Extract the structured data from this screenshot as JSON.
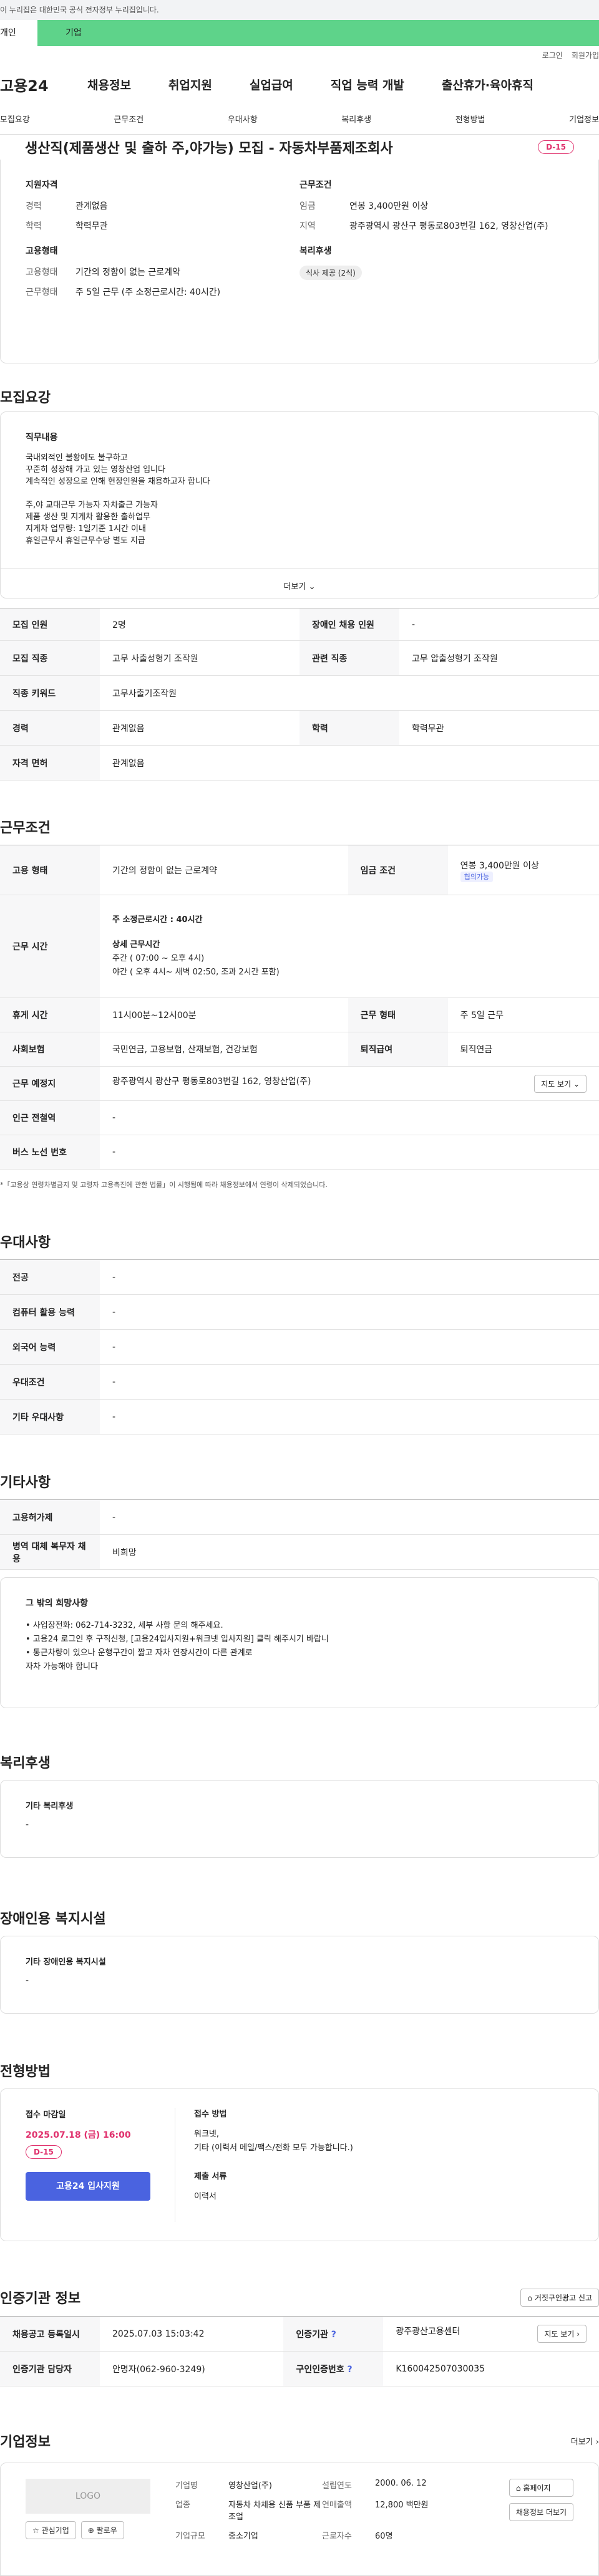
{
  "gov": {
    "notice": "이 누리집은 대한민국 공식 전자정부 누리집입니다."
  },
  "toptabs": [
    "개인",
    "기업"
  ],
  "util": [
    "로그인",
    "회원가입"
  ],
  "gnb": {
    "logo": "고용24",
    "menus": [
      "채용정보",
      "취업지원",
      "실업급여",
      "직업 능력 개발",
      "출산휴가·육아휴직"
    ]
  },
  "subnav": [
    "모집요강",
    "근무조건",
    "우대사항",
    "복리후생",
    "전형방법",
    "기업정보"
  ],
  "job": {
    "title": "생산직(제품생산 및 출하 주,야가능) 모집 - 자동차부품제조회사",
    "dday": "D-15"
  },
  "summary": {
    "q": {
      "title": "지원자격",
      "rows": [
        [
          "경력",
          "관계없음"
        ],
        [
          "학력",
          "학력무관"
        ]
      ]
    },
    "w": {
      "title": "근무조건",
      "rows": [
        [
          "임금",
          "연봉 3,400만원 이상"
        ],
        [
          "지역",
          "광주광역시 광산구 평동로803번길 162, 영창산업(주)"
        ]
      ]
    },
    "e": {
      "title": "고용형태",
      "rows": [
        [
          "고용형태",
          "기간의 정함이 없는 근로계약"
        ],
        [
          "근무형태",
          "주 5일 근무 (주 소정근로시간: 40시간)"
        ]
      ]
    },
    "b": {
      "title": "복리후생",
      "chip": "식사 제공 (2식)"
    }
  },
  "recruit": {
    "section": "모집요강",
    "dutyTitle": "직무내용",
    "lines": [
      "국내외적인 불황에도 불구하고",
      "꾸준히 성장해 가고 있는 영창산업 입니다",
      "계속적인 성장으로 인해 현장인원을 채용하고자 합니다",
      "",
      "주,야 교대근무 가능자 자차출근 가능자",
      "제품 생산 및 지게차 활용한 출하업무",
      "지게차 업무량: 1일기준 1시간 이내",
      "휴일근무시  휴일근무수당 별도 지급"
    ],
    "more": "더보기",
    "rows": [
      [
        "모집 인원",
        "2명",
        "장애인 채용 인원",
        "-"
      ],
      [
        "모집 직종",
        "고무 사출성형기 조작원",
        "관련 직종",
        "고무 압출성형기 조작원"
      ],
      [
        "직종 키워드",
        "고무사출기조작원",
        "",
        ""
      ],
      [
        "경력",
        "관계없음",
        "학력",
        "학력무관"
      ],
      [
        "자격 면허",
        "관계없음",
        "",
        ""
      ]
    ]
  },
  "work": {
    "section": "근무조건",
    "emp": [
      "고용 형태",
      "기간의 정함이 없는 근로계약",
      "임금 조건",
      "연봉 3,400만원 이상",
      "협의가능"
    ],
    "time": {
      "k": "근무 시간",
      "hours": "주 소정근로시간 : 40시간",
      "detail": "상세 근무시간",
      "l1": "주간 ( 07:00 ~ 오후 4시)",
      "l2": "야간 ( 오후 4시~ 새벽 02:50, 조과 2시간 포함)"
    },
    "rows": [
      [
        "휴게 시간",
        "11시00분~12시00분",
        "근무 형태",
        "주 5일 근무"
      ],
      [
        "사회보험",
        "국민연금, 고용보험, 산재보험, 건강보험",
        "퇴직급여",
        "퇴직연금"
      ]
    ],
    "place": [
      "근무 예정지",
      "광주광역시 광산구 평동로803번길 162, 영창산업(주)",
      "지도 보기"
    ],
    "rows2": [
      [
        "인근 전철역",
        "-"
      ],
      [
        "버스 노선 번호",
        "-"
      ]
    ],
    "note": "*「고용상 연령차별금지 및 고령자 고용촉진에 관한 법률」이 시행됨에 따라 채용정보에서 연령이 삭제되었습니다."
  },
  "pref": {
    "section": "우대사항",
    "rows": [
      [
        "전공",
        "-"
      ],
      [
        "컴퓨터 활용 능력",
        "-"
      ],
      [
        "외국어 능력",
        "-"
      ],
      [
        "우대조건",
        "-"
      ],
      [
        "기타 우대사항",
        "-"
      ]
    ]
  },
  "etc": {
    "section": "기타사항",
    "rows": [
      [
        "고용허가제",
        "-"
      ],
      [
        "병역 대체 복무자 채용",
        "비희망"
      ]
    ],
    "boxTitle": "그 밖의 희망사항",
    "bl": [
      "• 사업장전화: 062-714-3232, 세부 사항 문의 해주세요.",
      "• 고용24 로그인 후 구직신청,  [고용24입사지원+워크넷 입사지원] 클릭 해주시기 바랍니",
      "• 통근차량이 있으나  운행구간이  짧고 자차 연장시간이 다른 관계로",
      "   자차 가능해야 합니다"
    ]
  },
  "welfare": {
    "section": "복리후생",
    "k": "기타 복리후생",
    "v": "-"
  },
  "disab": {
    "section": "장애인용 복지시설",
    "k": "기타 장애인용 복지시설",
    "v": "-"
  },
  "process": {
    "section": "전형방법",
    "deadlineK": "접수 마감일",
    "deadline": "2025.07.18 (금) 16:00",
    "dday": "D-15",
    "apply": "고용24 입사지원",
    "methodK": "접수 방법",
    "m1": "워크넷,",
    "m2": "기타 (이력서 메일/팩스/전화 모두 가능합니다.)",
    "docsK": "제출 서류",
    "docs": "이력서"
  },
  "cert": {
    "section": "인증기관 정보",
    "report": "거짓구인광고 신고",
    "rows": [
      [
        "채용공고 등록일시",
        "2025.07.03 15:03:42",
        "인증기관",
        "광주광산고용센터",
        "지도 보기"
      ],
      [
        "인증기관 담당자",
        "안명자(062-960-3249)",
        "구인인증번호",
        "K160042507030035",
        ""
      ]
    ]
  },
  "company": {
    "section": "기업정보",
    "more": "더보기",
    "logo": "LOGO",
    "fav": "관심기업",
    "follow": "팔로우",
    "rows": [
      [
        "기업명",
        "영창산업(주)",
        "설립연도",
        "2000. 06. 12"
      ],
      [
        "업종",
        "자동차 차체용 신품 부품 제조업",
        "연매출액",
        "12,800 백만원"
      ],
      [
        "기업규모",
        "중소기업",
        "근로자수",
        "60명"
      ]
    ],
    "home": "홈페이지",
    "info": "채용정보 더보기"
  },
  "colors": {
    "accent": "#4a63e0",
    "green": "#5ed38a",
    "dday": "#e0306c"
  }
}
